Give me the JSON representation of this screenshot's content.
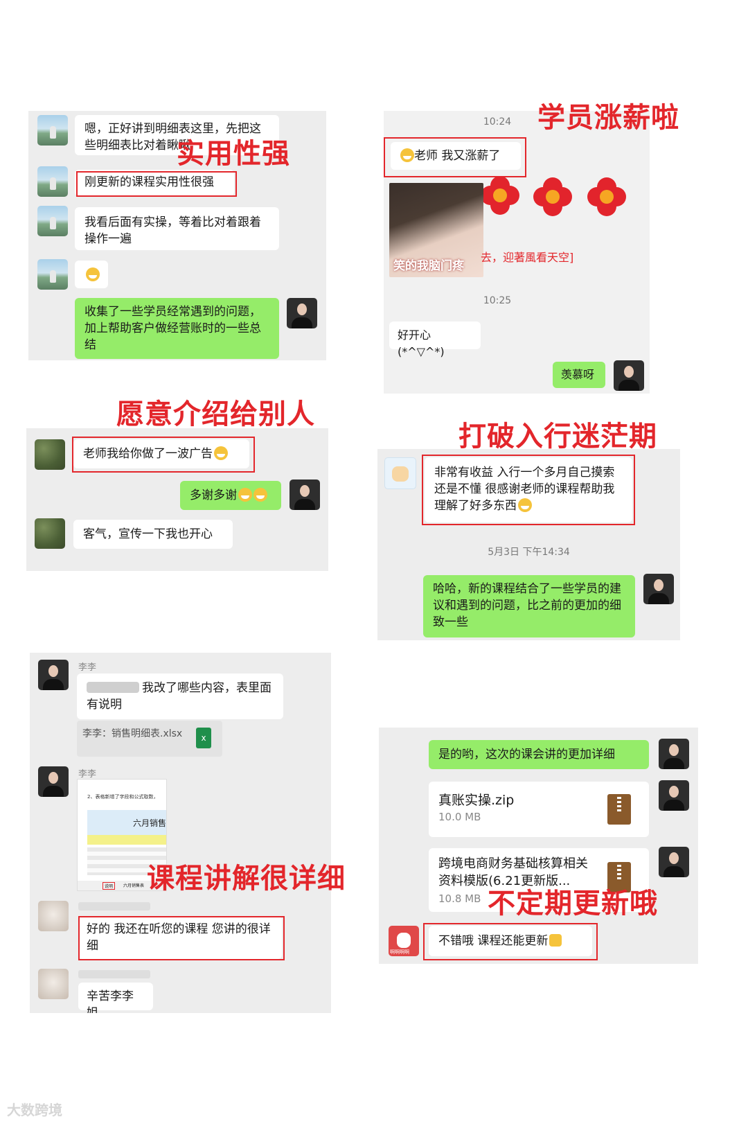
{
  "captions": {
    "c1": "实用性强",
    "c2": "学员涨薪啦",
    "c3": "愿意介绍给别人",
    "c4": "打破入行迷茫期",
    "c5": "课程讲解很详细",
    "c6": "不定期更新哦"
  },
  "panel1": {
    "msg1": "嗯，正好讲到明细表这里，先把这些明细表比对着瞅瞅",
    "msg2": "刚更新的课程实用性很强",
    "msg3": "我看后面有实操，等着比对着跟着操作一遍",
    "msg5": "收集了一些学员经常遇到的问题，加上帮助客户做经营账时的一些总结"
  },
  "panel2": {
    "time1": "10:24",
    "msg1": "老师  我又涨薪了",
    "sticker_text": "笑的我脑门疼",
    "bg_text": "去，迎著風看天空]",
    "time2": "10:25",
    "msg2": "好开心 (*^▽^*)",
    "msg3": "羡慕呀"
  },
  "panel3": {
    "msg1": "老师我给你做了一波广告",
    "msg2": "多谢多谢",
    "msg3": "客气，宣传一下我也开心"
  },
  "panel4": {
    "msg1": "非常有收益 入行一个多月自己摸索还是不懂  很感谢老师的课程帮助我理解了好多东西",
    "time": "5月3日 下午14:34",
    "msg2": "哈哈，新的课程结合了一些学员的建议和遇到的问题，比之前的更加的细致一些"
  },
  "panel5": {
    "sender1": "李李",
    "msg1": "我改了哪些内容，表里面有说明",
    "file_name": "李李：销售明细表.xlsx",
    "file_ext": "x",
    "sender2": "李李",
    "sheet_note": "2、表格新增了字段和公式取数，",
    "sheet_title": "六月销售",
    "sheet_tab1": "说明",
    "sheet_tab2": "六月销售表",
    "msg3": "好的 我还在听您的课程 您讲的很详细",
    "msg4": "辛苦李李姐"
  },
  "panel6": {
    "msg1": "是的哟，这次的课会讲的更加详细",
    "file1_name": "真账实操.zip",
    "file1_size": "10.0 MB",
    "file2_name": "跨境电商财务基础核算相关资料模版(6.21更新版...",
    "file2_size": "10.8 MB",
    "msg4": "不错哦 课程还能更新",
    "avatar_text": "啊啊啊啊"
  },
  "watermark": "大数跨境",
  "colors": {
    "accent": "#e3262b",
    "bubble_green": "#95ec69",
    "panel_bg": "#ededed"
  }
}
